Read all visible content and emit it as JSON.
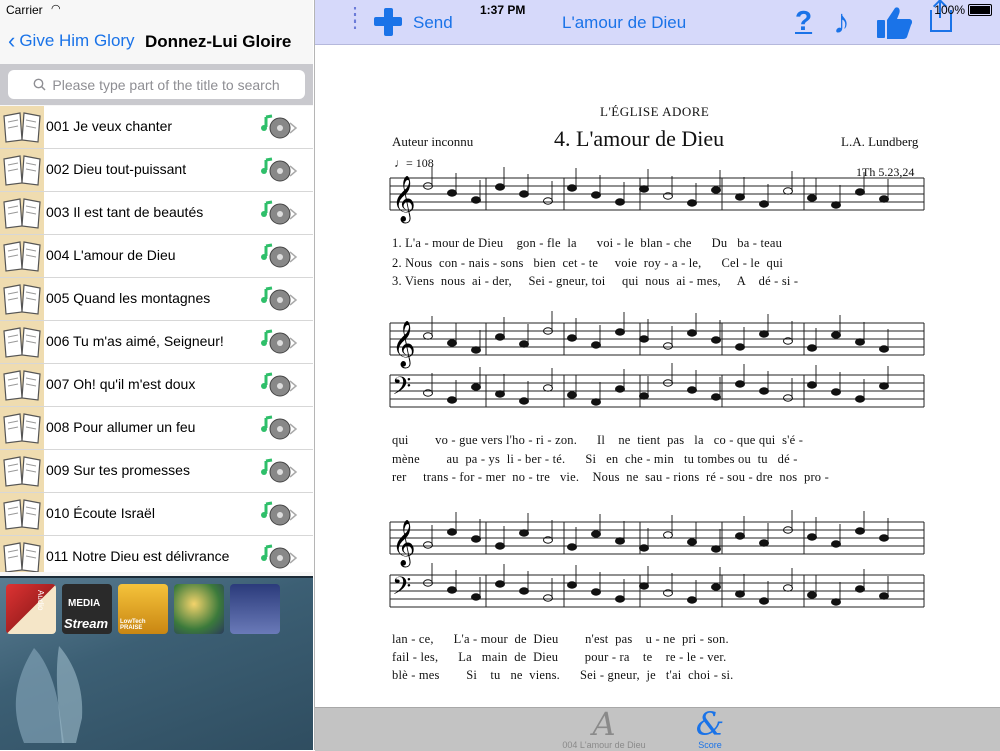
{
  "status": {
    "carrier": "Carrier",
    "time": "1:37 PM",
    "battery": "100%"
  },
  "left_nav": {
    "back_label": "Give Him Glory",
    "title": "Donnez-Lui Gloire"
  },
  "search": {
    "placeholder": "Please type part of the title to search"
  },
  "hymns": [
    {
      "title": "001 Je veux chanter"
    },
    {
      "title": "002 Dieu tout-puissant"
    },
    {
      "title": "003 Il est tant de beautés"
    },
    {
      "title": "004 L'amour de Dieu"
    },
    {
      "title": "005 Quand les montagnes"
    },
    {
      "title": "006 Tu m'as aimé, Seigneur!"
    },
    {
      "title": "007 Oh! qu'il m'est doux"
    },
    {
      "title": "008 Pour allumer un feu"
    },
    {
      "title": "009 Sur tes promesses"
    },
    {
      "title": "010 Écoute Israël"
    },
    {
      "title": "011 Notre Dieu est délivrance"
    }
  ],
  "apps": [
    {
      "name": "audio-app-icon",
      "label": "Audio"
    },
    {
      "name": "media-stream-icon",
      "label": "MEDIA",
      "sub": "Stream"
    },
    {
      "name": "lowtech-praise-icon",
      "label": "LowTech PRAISE"
    },
    {
      "name": "hymn-app-icon",
      "label": ""
    },
    {
      "name": "book-app-icon",
      "label": ""
    }
  ],
  "right_nav": {
    "send_label": "Send",
    "title": "L'amour de Dieu",
    "help": "?",
    "music_note": "♪"
  },
  "score": {
    "church": "L'ÉGLISE ADORE",
    "author": "Auteur inconnu",
    "title": "4. L'amour de Dieu",
    "composer": "L.A. Lundberg",
    "tempo": "♩= 108",
    "reference": "1Th 5.23,24",
    "system1_lyrics": [
      "1. L'a - mour de Dieu    gon - fle  la      voi - le  blan - che      Du   ba - teau",
      "2. Nous  con - nais - sons   bien  cet - te     voie  roy - a - le,      Cel - le  qui",
      "3. Viens  nous  ai - der,     Sei - gneur, toi     qui  nous  ai - mes,     A    dé - si -"
    ],
    "system2_lyrics": [
      "qui        vo - gue vers l'ho - ri - zon.      Il    ne  tient  pas   la   co - que qui  s'é -",
      "mène        au  pa - ys  li - ber - té.      Si   en  che - min   tu tombes ou  tu   dé -",
      "rer     trans - for - mer  no - tre   vie.    Nous  ne  sau - rions  ré - sou - dre  nos  pro -"
    ],
    "system3_lyrics": [
      "lan - ce,      L'a - mour  de  Dieu        n'est  pas    u - ne  pri - son.",
      "fail - les,      La   main  de  Dieu        pour - ra    te    re - le - ver.",
      "blè - mes        Si    tu   ne  viens.      Sei - gneur,  je   t'ai  choi - si."
    ]
  },
  "tabs": [
    {
      "icon": "A",
      "label": "004 L'amour de Dieu"
    },
    {
      "icon": "&",
      "label": "Score"
    }
  ],
  "colors": {
    "accent": "#1a73e8",
    "nav_right_bg": "#d6d9fa",
    "book_bg": "#efdcb0"
  }
}
